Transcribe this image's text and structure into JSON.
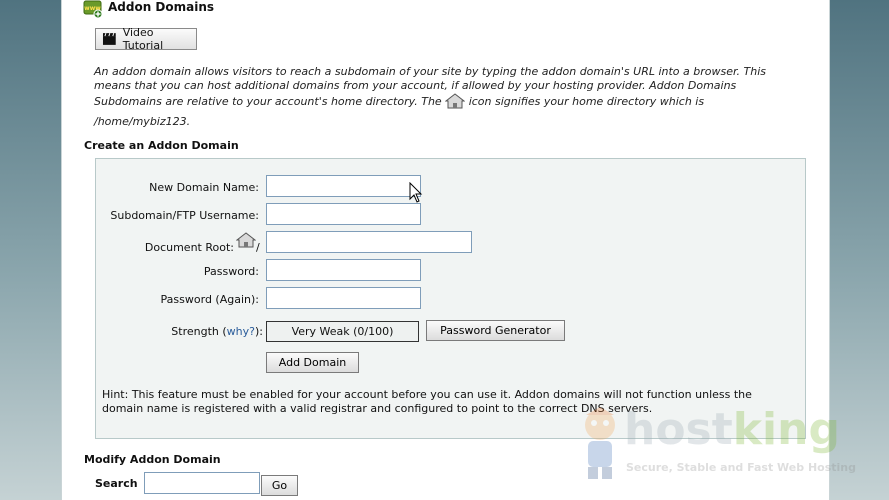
{
  "page": {
    "title": "Addon Domains",
    "video_button": "Video Tutorial",
    "intro_part1": "An addon domain allows visitors to reach a subdomain of your site by typing the addon domain's URL into a browser. This means that you can host additional domains from your account, if allowed by your hosting provider. Addon Domains Subdomains are relative to your account's home directory. The",
    "intro_part2": "icon signifies your home directory which is",
    "home_path": "/home/mybiz123."
  },
  "create": {
    "heading": "Create an Addon Domain",
    "fields": {
      "new_domain_label": "New Domain Name:",
      "new_domain_value": "",
      "subdomain_label": "Subdomain/FTP Username:",
      "subdomain_value": "",
      "docroot_label": "Document Root:",
      "docroot_slash": "/",
      "docroot_value": "",
      "password_label": "Password:",
      "password_again_label": "Password (Again):"
    },
    "strength_label": "Strength",
    "strength_open": "(",
    "strength_why": "why?",
    "strength_close": "):",
    "strength_value": "Very Weak (0/100)",
    "password_generator_button": "Password Generator",
    "add_domain_button": "Add Domain",
    "hint": "Hint: This feature must be enabled for your account before you can use it. Addon domains will not function unless the domain name is registered with a valid registrar and configured to point to the correct DNS servers."
  },
  "modify": {
    "heading": "Modify Addon Domain",
    "search_label": "Search",
    "search_value": "",
    "go_button": "Go"
  },
  "watermark": {
    "brand_host": "host",
    "brand_king": "king",
    "tagline": "Secure, Stable and Fast Web Hosting"
  },
  "icons": [
    "addon-domains-icon",
    "clapperboard-icon",
    "home-icon",
    "mouse-cursor-icon",
    "mascot-icon"
  ],
  "colors": {
    "accent_link": "#2a5c9a",
    "box_bg": "#f1f4f3",
    "box_border": "#b8c9c9",
    "brand_orange": "#e8742a",
    "brand_green": "#7ab52e"
  }
}
